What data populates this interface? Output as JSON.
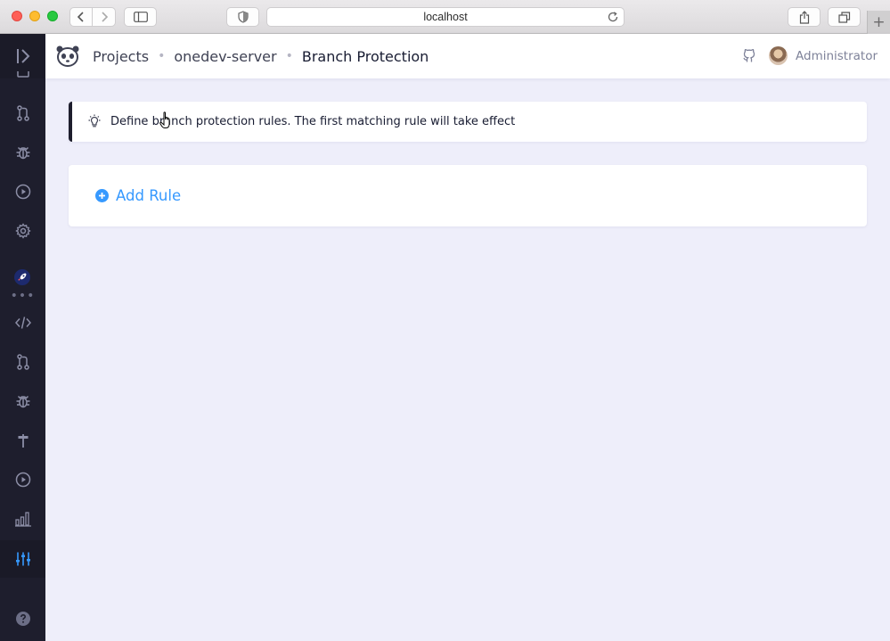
{
  "browser": {
    "url": "localhost"
  },
  "sidebar": {
    "items": [
      {
        "name": "pull-requests",
        "icon": "git-pull-request-icon"
      },
      {
        "name": "issues",
        "icon": "bug-icon"
      },
      {
        "name": "builds",
        "icon": "play-circle-icon"
      },
      {
        "name": "settings",
        "icon": "gear-icon"
      },
      {
        "name": "code",
        "icon": "code-icon"
      },
      {
        "name": "pull-requests-2",
        "icon": "git-pull-request-icon"
      },
      {
        "name": "issues-2",
        "icon": "bug-icon"
      },
      {
        "name": "commits",
        "icon": "commit-icon"
      },
      {
        "name": "builds-2",
        "icon": "play-circle-icon"
      },
      {
        "name": "statistics",
        "icon": "bar-chart-icon"
      },
      {
        "name": "project-settings",
        "icon": "sliders-icon",
        "active": true
      },
      {
        "name": "help",
        "icon": "help-icon"
      }
    ],
    "accent": "#3699ff"
  },
  "header": {
    "breadcrumbs": [
      "Projects",
      "onedev-server",
      "Branch Protection"
    ],
    "user_name": "Administrator"
  },
  "main": {
    "notice": "Define branch protection rules. The first matching rule will take effect",
    "add_rule_label": "Add Rule"
  },
  "colors": {
    "sidebar_bg": "#1e1e2d",
    "content_bg": "#eeeefa",
    "link_blue": "#3699ff"
  }
}
